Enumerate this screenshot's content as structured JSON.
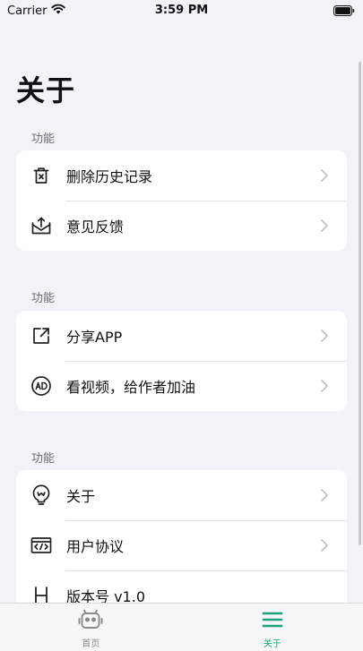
{
  "status_bar": {
    "carrier": "Carrier",
    "time": "3:59 PM"
  },
  "page": {
    "title": "关于"
  },
  "sections": [
    {
      "header": "功能",
      "items": [
        {
          "label": "删除历史记录",
          "icon": "trash-icon"
        },
        {
          "label": "意见反馈",
          "icon": "inbox-upload-icon"
        }
      ]
    },
    {
      "header": "功能",
      "items": [
        {
          "label": "分享APP",
          "icon": "share-external-icon"
        },
        {
          "label": "看视频，给作者加油",
          "icon": "ad-icon"
        }
      ]
    },
    {
      "header": "功能",
      "items": [
        {
          "label": "关于",
          "icon": "bulb-icon"
        },
        {
          "label": "用户协议",
          "icon": "code-document-icon"
        },
        {
          "label": "版本号 v1.0",
          "icon": "h-letter-icon"
        }
      ]
    }
  ],
  "tab_bar": {
    "tabs": [
      {
        "label": "首页",
        "icon": "robot-icon",
        "selected": false
      },
      {
        "label": "关于",
        "icon": "menu-icon",
        "selected": true
      }
    ]
  },
  "colors": {
    "background": "#f2f2f7",
    "card": "#ffffff",
    "accent": "#1aa07a",
    "section_header": "#6d6d72",
    "chevron": "#c4c4c7"
  }
}
